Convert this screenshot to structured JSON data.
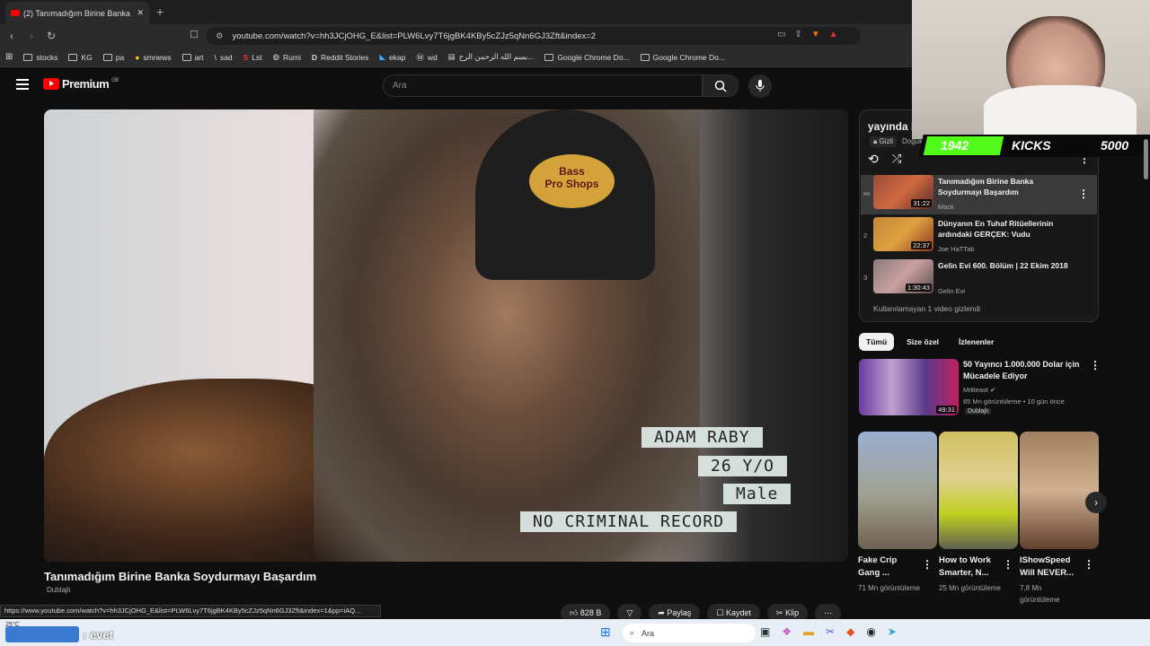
{
  "browser": {
    "tab_title": "(2) Tanımadığım Birine Banka",
    "url": "youtube.com/watch?v=hh3JCjOHG_E&list=PLW6Lvy7T6jgBK4KBy5cZJz5qNn6GJ3Zft&index=2",
    "bookmarks": [
      "stocks",
      "KG",
      "pa",
      "smnews",
      "art",
      "sad",
      "Lst",
      "Rumi",
      "Reddit Stories",
      "ekap",
      "wd",
      "بسم الله الرحمن الرح...",
      "Google Chrome Do...",
      "Google Chrome Do..."
    ],
    "status_url": "https://www.youtube.com/watch?v=hh3JCjOHG_E&list=PLW6Lvy7T6jgBK4KBy5cZJz5qNn6GJ3Zft&index=1&pp=iAQ..."
  },
  "youtube": {
    "logo": "Premium",
    "logo_region": "GB",
    "search_placeholder": "Ara"
  },
  "video": {
    "overlay": [
      "ADAM RABY",
      "26 Y/O",
      "Male",
      "NO CRIMINAL RECORD"
    ],
    "title": "Tanımadığım Birine Banka Soydurmayı Başardım",
    "dubbed": "Dublajlı",
    "likes": "828 B",
    "share": "Paylaş",
    "save": "Kaydet",
    "clip": "Klip"
  },
  "playlist": {
    "title": "yayında i",
    "privacy": "Gizli",
    "owner": "Doğukan",
    "items": [
      {
        "num": "",
        "title": "Tanımadığım Birine Banka Soydurmayı Başardım",
        "channel": "Mack",
        "duration": "31:22"
      },
      {
        "num": "2",
        "title": "Dünyanın En Tuhaf Ritüellerinin ardındaki GERÇEK: Vudu",
        "channel": "Joe HaTTab",
        "duration": "22:37"
      },
      {
        "num": "3",
        "title": "Gelin Evi 600. Bölüm | 22 Ekim 2018",
        "channel": "Gelin Evi",
        "duration": "1:30:43"
      }
    ],
    "hidden_note": "Kullanılamayan 1 video gizlendi"
  },
  "chips": [
    "Tümü",
    "Size özel",
    "İzlenenler"
  ],
  "recommended": {
    "title": "50 Yayıncı 1.000.000 Dolar için Mücadele Ediyor",
    "channel": "MrBeast",
    "meta": "85 Mn görüntüleme • 10 gün önce",
    "badge": "Dublajlı",
    "duration": "49:31"
  },
  "shorts": [
    {
      "title": "Fake Crip Gang ...",
      "views": "71 Mn görüntüleme"
    },
    {
      "title": "How to Work Smarter, N...",
      "views": "25 Mn görüntüleme"
    },
    {
      "title": "IShowSpeed Will NEVER...",
      "views": "7,8 Mn görüntüleme"
    }
  ],
  "overlay": {
    "count_left": "1942",
    "label": "KICKS",
    "count_right": "5000"
  },
  "taskbar": {
    "weather": "25°C",
    "user_label": "evet",
    "search": "Ara"
  }
}
